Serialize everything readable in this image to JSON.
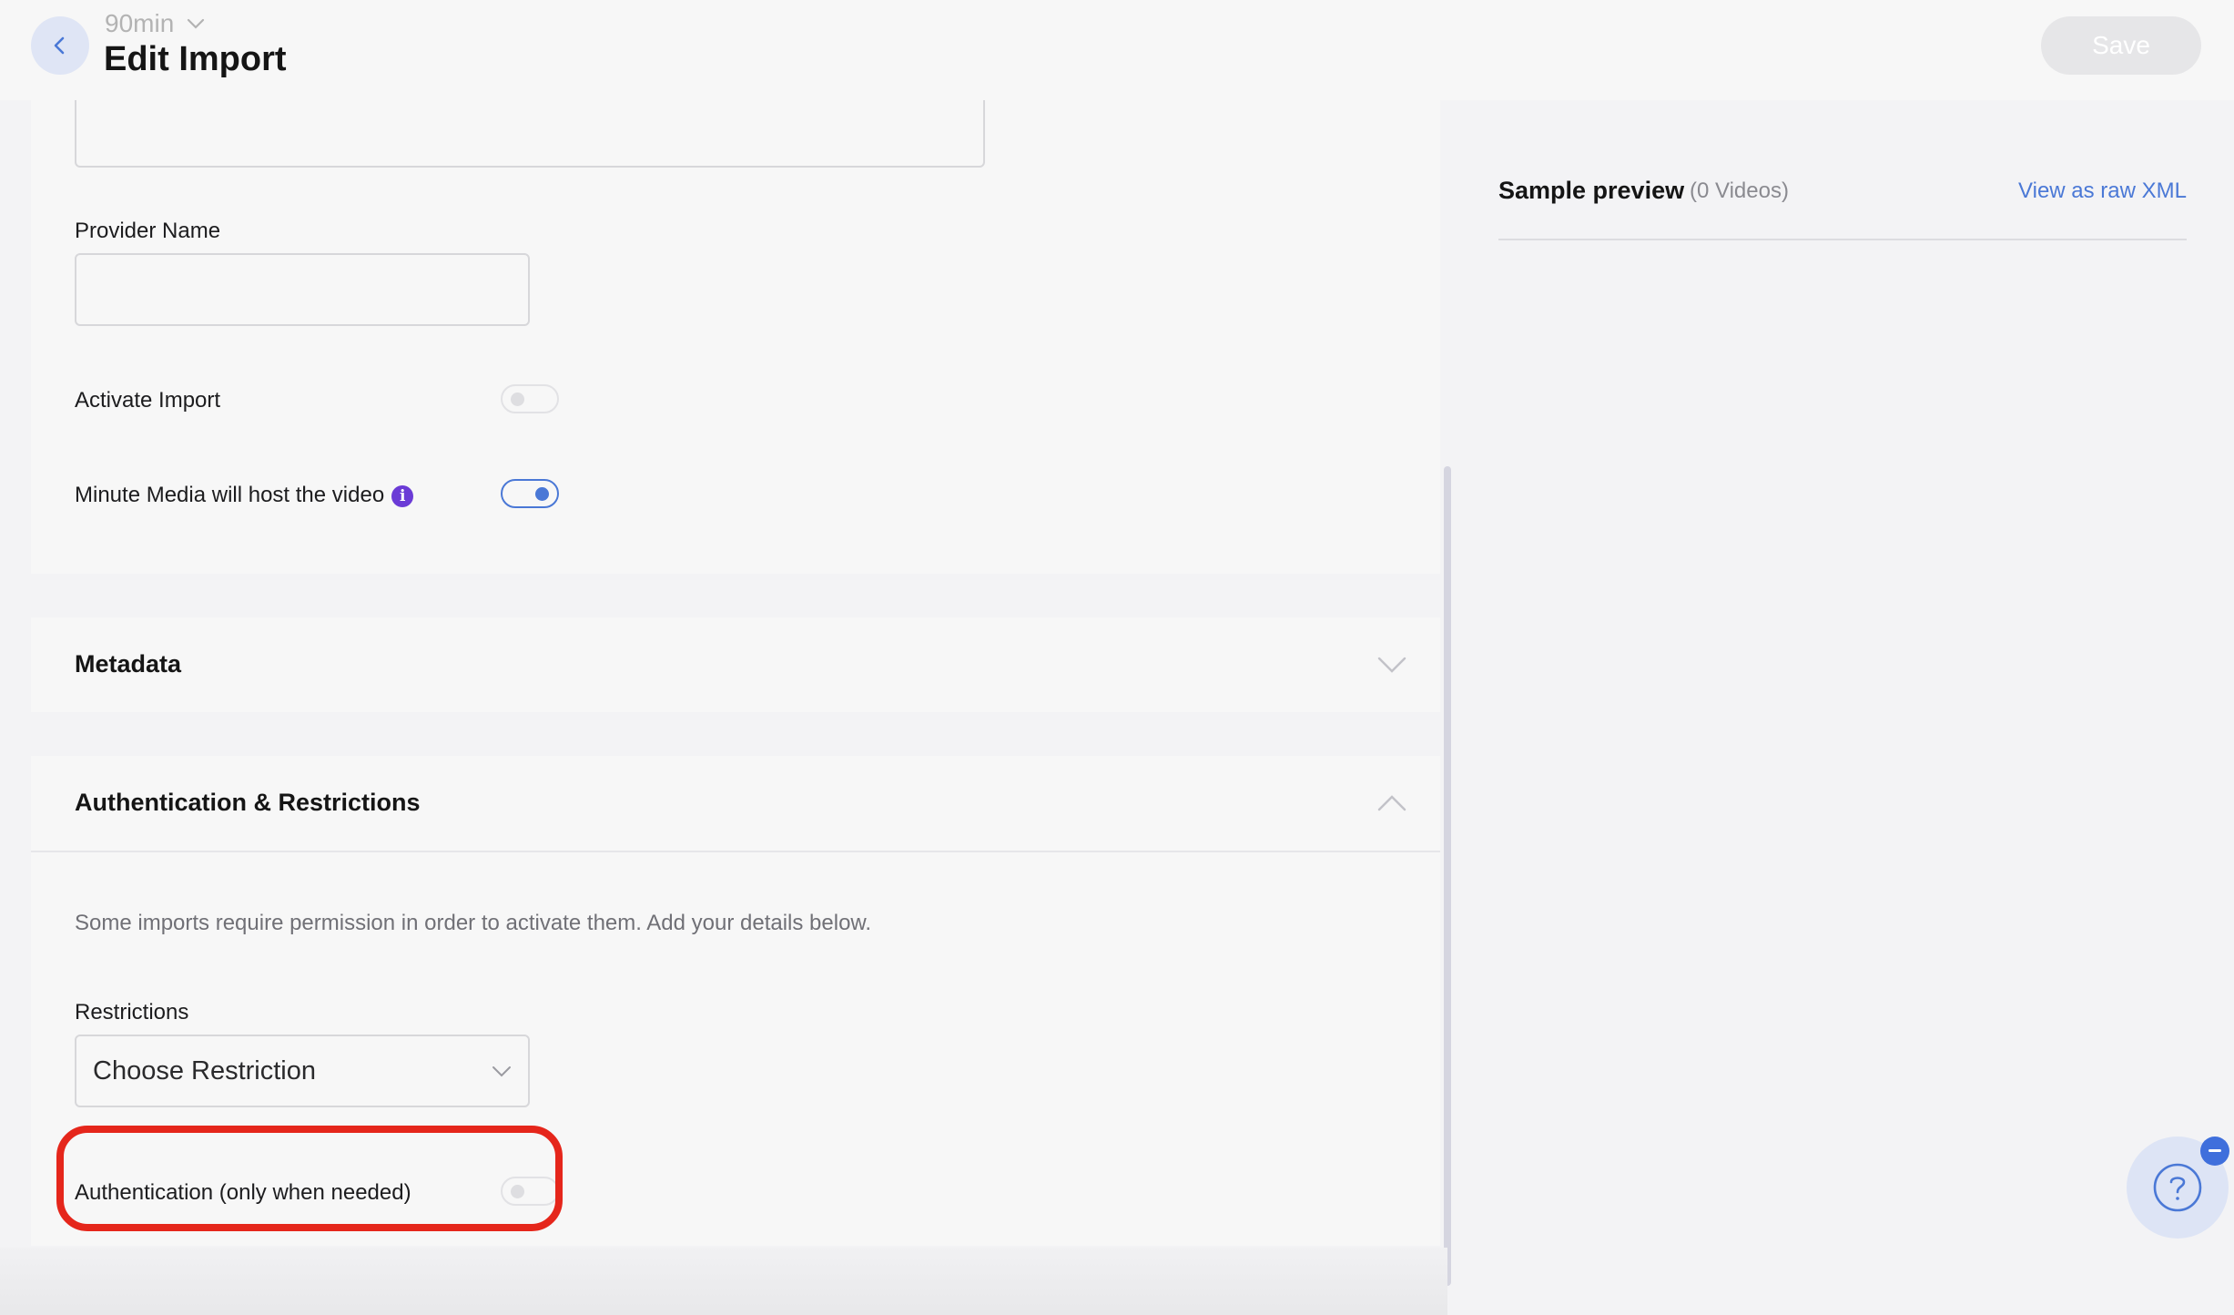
{
  "header": {
    "context_label": "90min",
    "title": "Edit Import",
    "save_label": "Save"
  },
  "form": {
    "provider_name_label": "Provider Name",
    "provider_name_value": "",
    "activate_import_label": "Activate Import",
    "activate_import_on": false,
    "host_video_label": "Minute Media will host the video",
    "host_video_on": true
  },
  "sections": {
    "metadata_title": "Metadata",
    "metadata_expanded": false,
    "auth_title": "Authentication & Restrictions",
    "auth_expanded": true,
    "auth_description": "Some imports require permission in order to activate them. Add your details below.",
    "restrictions_label": "Restrictions",
    "restrictions_selected": "Choose Restriction",
    "authentication_label": "Authentication (only when needed)",
    "authentication_on": false
  },
  "preview": {
    "title": "Sample preview",
    "count": "(0 Videos)",
    "raw_xml_link": "View as raw XML"
  },
  "colors": {
    "accent": "#4a78d6",
    "highlight": "#e5261b",
    "info": "#6b3bd6"
  },
  "icons": [
    "chevron-left-icon",
    "chevron-down-icon",
    "chevron-up-icon",
    "info-icon",
    "help-icon",
    "minus-icon"
  ]
}
